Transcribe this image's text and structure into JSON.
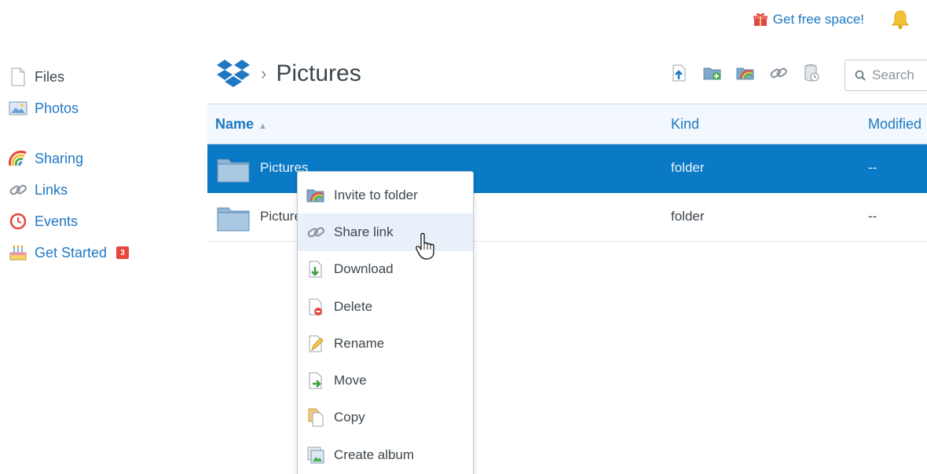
{
  "topbar": {
    "free_space_label": "Get free space!"
  },
  "sidebar": {
    "items": [
      {
        "label": "Files",
        "icon": "file-icon"
      },
      {
        "label": "Photos",
        "icon": "photos-icon"
      },
      {
        "label": "Sharing",
        "icon": "rainbow-icon"
      },
      {
        "label": "Links",
        "icon": "link-icon"
      },
      {
        "label": "Events",
        "icon": "events-icon"
      },
      {
        "label": "Get Started",
        "icon": "cake-icon",
        "badge": "3"
      }
    ]
  },
  "breadcrumb": {
    "separator": "›",
    "title": "Pictures"
  },
  "search": {
    "placeholder": "Search"
  },
  "file_list": {
    "columns": {
      "name": "Name",
      "kind": "Kind",
      "modified": "Modified"
    },
    "sort_arrow": "▲",
    "rows": [
      {
        "name": "Pictures",
        "kind": "folder",
        "modified": "--",
        "selected": true
      },
      {
        "name": "Pictures",
        "kind": "folder",
        "modified": "--",
        "selected": false
      }
    ]
  },
  "context_menu": {
    "items": [
      {
        "label": "Invite to folder",
        "icon": "shared-folder-icon"
      },
      {
        "label": "Share link",
        "icon": "link-icon"
      },
      {
        "label": "Download",
        "icon": "download-icon"
      },
      {
        "label": "Delete",
        "icon": "delete-icon"
      },
      {
        "label": "Rename",
        "icon": "rename-icon"
      },
      {
        "label": "Move",
        "icon": "move-icon"
      },
      {
        "label": "Copy",
        "icon": "copy-icon"
      },
      {
        "label": "Create album",
        "icon": "create-album-icon"
      }
    ]
  },
  "colors": {
    "accent": "#1f78c4",
    "selected_row": "#0a79c6",
    "menu_hover": "#e8f1f9",
    "badge": "#e8453c"
  }
}
